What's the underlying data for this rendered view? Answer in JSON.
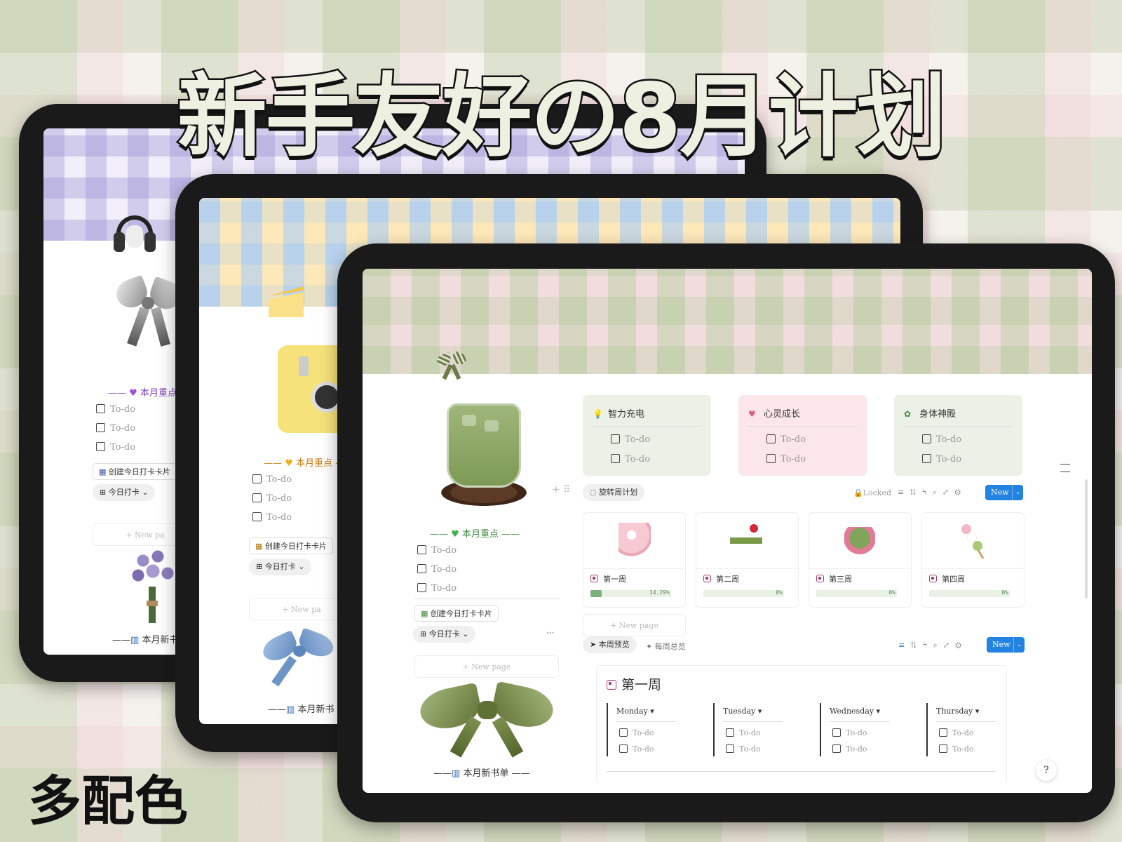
{
  "headline": "新手友好の8月计划",
  "subtitle": "多配色",
  "colors": {
    "green_accent": "#7cb27a",
    "purple_accent": "#7a3fb8",
    "orange_accent": "#d9820c",
    "new_button": "#2383e2"
  },
  "back_tablet": {
    "section_title": "本月重点",
    "section_icon": "purple-heart-icon",
    "todos": [
      "To-do",
      "To-do",
      "To-do"
    ],
    "create_card_label": "创建今日打卡卡片",
    "checkin_label": "今日打卡",
    "new_page_label": "New pa",
    "books_label": "本月新书"
  },
  "middle_tablet": {
    "section_title": "本月重点",
    "section_icon": "yellow-heart-icon",
    "todos": [
      "To-do",
      "To-do",
      "To-do"
    ],
    "create_card_label": "创建今日打卡卡片",
    "checkin_label": "今日打卡",
    "new_page_label": "New pa",
    "books_label": "本月新书"
  },
  "front": {
    "left": {
      "section_title": "本月重点",
      "todos": [
        "To-do",
        "To-do",
        "To-do"
      ],
      "create_card_label": "创建今日打卡卡片",
      "checkin_label": "今日打卡",
      "new_page_label": "New page",
      "books_label": "本月新书单"
    },
    "categories": [
      {
        "title": "智力充电",
        "icon": "lightbulb-icon",
        "todos": [
          "To-do",
          "To-do"
        ],
        "bg": "#ebf1e6"
      },
      {
        "title": "心灵成长",
        "icon": "heart-icon",
        "todos": [
          "To-do",
          "To-do"
        ],
        "bg": "#fbe6ea"
      },
      {
        "title": "身体神殿",
        "icon": "flower-badge-icon",
        "todos": [
          "To-do",
          "To-do"
        ],
        "bg": "#ebf1e6"
      }
    ],
    "weekly_tab": "旋转周计划",
    "toolbar": {
      "locked": "Locked",
      "new": "New"
    },
    "weeks": [
      {
        "name": "第一周",
        "progress": "14.29%",
        "progress_value": 14.29
      },
      {
        "name": "第二周",
        "progress": "0%",
        "progress_value": 0
      },
      {
        "name": "第三周",
        "progress": "0%",
        "progress_value": 0
      },
      {
        "name": "第四周",
        "progress": "0%",
        "progress_value": 0
      }
    ],
    "weeks_new_page": "New page",
    "tabs": [
      {
        "label": "本周预览"
      },
      {
        "label": "每周总览"
      }
    ],
    "toolbar2": {
      "new": "New"
    },
    "week_card": {
      "title": "第一周",
      "days": [
        {
          "name": "Monday",
          "todos": [
            "To-do",
            "To-do"
          ]
        },
        {
          "name": "Tuesday",
          "todos": [
            "To-do",
            "To-do"
          ]
        },
        {
          "name": "Wednesday",
          "todos": [
            "To-do",
            "To-do"
          ]
        },
        {
          "name": "Thursday",
          "todos": [
            "To-do",
            "To-do"
          ]
        }
      ]
    }
  }
}
